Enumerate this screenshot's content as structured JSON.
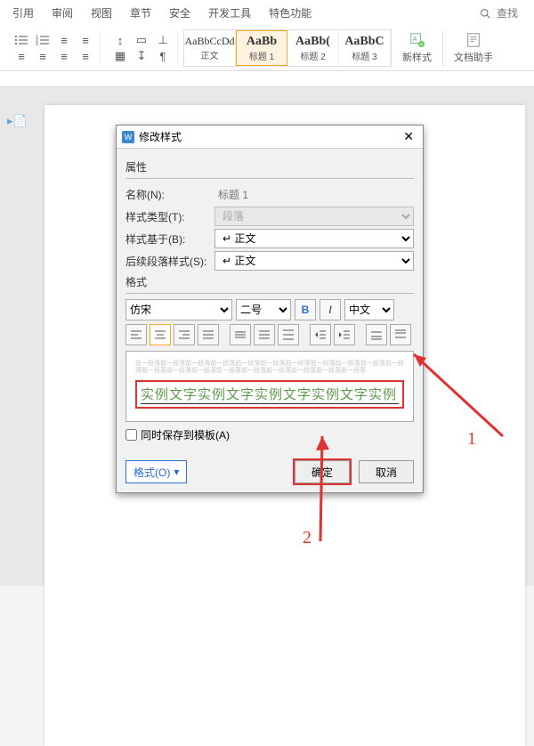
{
  "ribbon": {
    "tabs": [
      "引用",
      "审阅",
      "视图",
      "章节",
      "安全",
      "开发工具",
      "特色功能"
    ],
    "search_label": "查找"
  },
  "style_gallery": [
    {
      "preview": "AaBbCcDd",
      "label": "正文",
      "big": false
    },
    {
      "preview": "AaBb",
      "label": "标题 1",
      "big": true,
      "selected": true
    },
    {
      "preview": "AaBb(",
      "label": "标题 2",
      "big": true
    },
    {
      "preview": "AaBbC",
      "label": "标题 3",
      "big": true
    }
  ],
  "new_style": "新样式",
  "doc_assistant": "文档助手",
  "dialog": {
    "title": "修改样式",
    "section_props": "属性",
    "name_label": "名称(N):",
    "name_value": "标题 1",
    "type_label": "样式类型(T):",
    "type_value": "段落",
    "based_label": "样式基于(B):",
    "based_value": "↵ 正文",
    "follow_label": "后续段落样式(S):",
    "follow_value": "↵ 正文",
    "section_format": "格式",
    "font_name": "仿宋",
    "font_size": "二号",
    "bold": "B",
    "italic": "I",
    "lang": "中文",
    "preview_faint": "前一段落前一段落前一段落前一段落前一段落前一段落前一段落前一段落前一段落前一段落前一段落前一段落前一段落前一段落前一段落前一段落前一段落前一段落前一段落前一段落",
    "sample_text": "实例文字实例文字实例文字实例文字实例",
    "save_template": "同时保存到模板(A)",
    "format_menu": "格式(O)",
    "ok": "确定",
    "cancel": "取消"
  },
  "annotations": {
    "a1": "1",
    "a2": "2"
  }
}
